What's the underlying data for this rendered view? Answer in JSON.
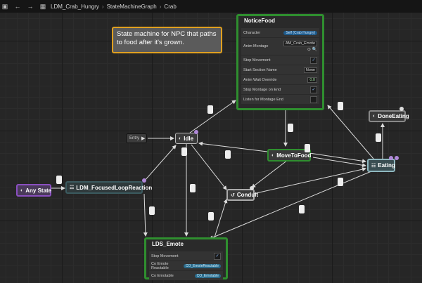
{
  "breadcrumb": {
    "items": [
      "LDM_Crab_Hungry",
      "StateMachineGraph",
      "Crab"
    ],
    "separator": "›"
  },
  "comment": {
    "text": "State machine for NPC that paths to food after it's grown."
  },
  "nodes": {
    "entry": "Entry",
    "idle": "Idle",
    "any_state": "Any State",
    "focused": "LDM_FocusedLoopReaction",
    "move_to_food": "MoveToFood",
    "eating": "Eating",
    "done_eating": "DoneEating",
    "conduit": "Conduit"
  },
  "notice_food": {
    "title": "NoticeFood",
    "rows": [
      {
        "label": "Character",
        "value": "Self (Crab Hungry)"
      },
      {
        "label": "Anim Montage",
        "value": "AM_Crab_Emote"
      },
      {
        "label": "Stop Movement",
        "value": "✓"
      },
      {
        "label": "Start Section Name",
        "value": "None"
      },
      {
        "label": "Anim Wait Override",
        "value": "0.0"
      },
      {
        "label": "Stop Montage on End",
        "value": "✓"
      },
      {
        "label": "Listen for Montage End",
        "value": ""
      }
    ]
  },
  "lds_emote": {
    "title": "LDS_Emote",
    "rows": [
      {
        "label": "Stop Movement",
        "value": "✓"
      },
      {
        "label": "Co Emote Reactable",
        "value": "CO_EmoteReactable"
      },
      {
        "label": "Co Emotable",
        "value": "CO_Emotable"
      }
    ]
  },
  "colors": {
    "accent_green": "#2f8f2f",
    "comment_border": "#e0a020",
    "any_state": "#8a4fc0"
  }
}
